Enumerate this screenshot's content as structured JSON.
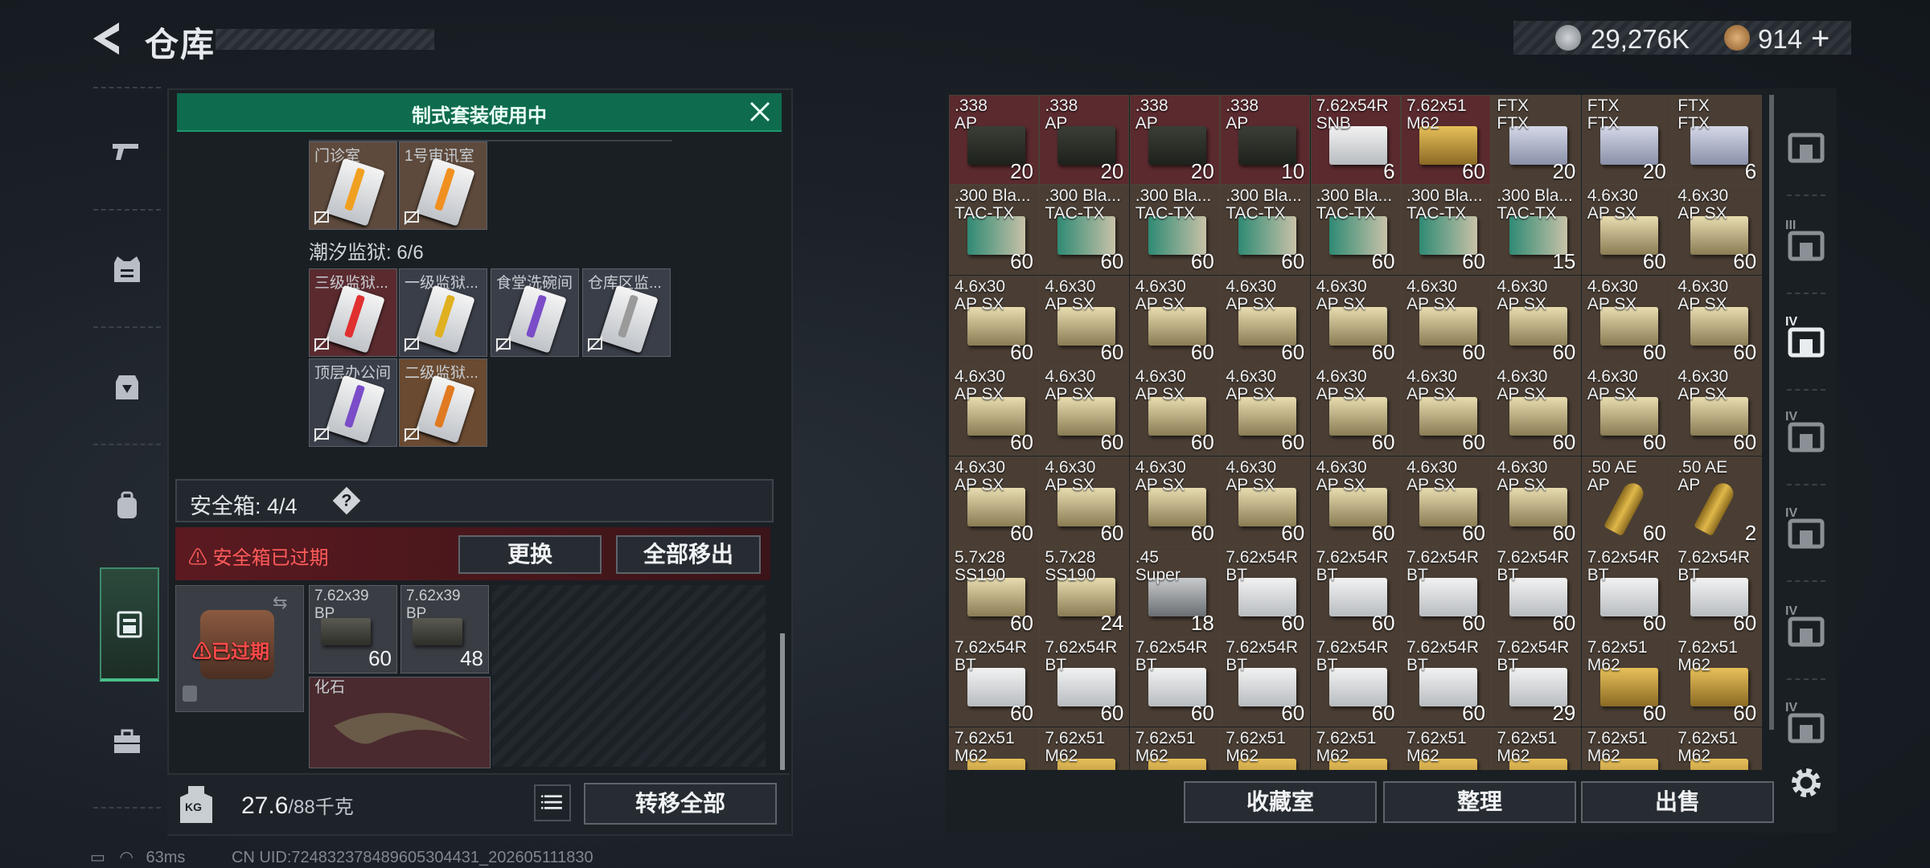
{
  "header": {
    "title": "仓库",
    "currency": [
      {
        "icon": "silver-coin-icon",
        "value": "29,276K"
      },
      {
        "icon": "bronze-coin-icon",
        "value": "914"
      }
    ]
  },
  "nav": [
    "weapon-icon",
    "armor-icon",
    "backpack-icon",
    "bag-icon",
    "container-icon",
    "toolbox-icon"
  ],
  "loadout_banner": "制式套装使用中",
  "keycards_top": [
    {
      "label": "门诊室",
      "color": "#f0a020"
    },
    {
      "label": "1号审讯室",
      "color": "#f09020"
    }
  ],
  "prison_label": "潮汐监狱: 6/6",
  "keycards_prison": [
    {
      "label": "三级监狱...",
      "bg": "#5a2a2e",
      "color": "#e03030"
    },
    {
      "label": "一级监狱...",
      "bg": "#3a3e48",
      "color": "#e0b020"
    },
    {
      "label": "食堂洗碗间",
      "bg": "#3a3e48",
      "color": "#7b4cc8"
    },
    {
      "label": "仓库区监...",
      "bg": "#3a3e48",
      "color": "#9a9a9a"
    },
    {
      "label": "顶层办公间",
      "bg": "#3a3e48",
      "color": "#7b4cc8"
    },
    {
      "label": "二级监狱...",
      "bg": "#6a4a30",
      "color": "#e07a20"
    }
  ],
  "safebox": {
    "label": "安全箱: 4/4",
    "help": "?",
    "expired_warning": "安全箱已过期",
    "replace_button": "更换",
    "remove_all_button": "全部移出",
    "slot_status": "已过期",
    "items": [
      {
        "label": "7.62x39\nBP",
        "count": "60"
      },
      {
        "label": "7.62x39\nBP",
        "count": "48"
      },
      {
        "label": "化石",
        "count": ""
      }
    ]
  },
  "weight": {
    "current": "27.6",
    "max": "/88千克",
    "icon_text": "KG"
  },
  "transfer_all_button": "转移全部",
  "stash_buttons": [
    "收藏室",
    "整理",
    "出售"
  ],
  "footer": {
    "ping": "63ms",
    "uid": "CN UID:724832378489605304431_202605111830"
  },
  "stash_items": [
    {
      "l": ".338\nAP",
      "c": "20",
      "t": "ammo_can",
      "bg": "#5a2a2e"
    },
    {
      "l": ".338\nAP",
      "c": "20",
      "t": "ammo_can",
      "bg": "#5a2a2e"
    },
    {
      "l": ".338\nAP",
      "c": "20",
      "t": "ammo_can",
      "bg": "#5a2a2e"
    },
    {
      "l": ".338\nAP",
      "c": "10",
      "t": "ammo_can",
      "bg": "#5a2a2e"
    },
    {
      "l": "7.62x54R\nSNB",
      "c": "6",
      "t": "white",
      "bg": "#5a2a2e"
    },
    {
      "l": "7.62x51\nM62",
      "c": "60",
      "t": "gold",
      "bg": "#5a2a2e"
    },
    {
      "l": "FTX\nFTX",
      "c": "20",
      "t": "silver",
      "bg": "#4a3e34"
    },
    {
      "l": "FTX\nFTX",
      "c": "20",
      "t": "silver",
      "bg": "#4a3e34"
    },
    {
      "l": "FTX\nFTX",
      "c": "6",
      "t": "silver",
      "bg": "#4a3e34"
    },
    {
      "l": ".300 Bla...\nTAC-TX",
      "c": "60",
      "t": "teal",
      "bg": "#4a3e34"
    },
    {
      "l": ".300 Bla...\nTAC-TX",
      "c": "60",
      "t": "teal",
      "bg": "#4a3e34"
    },
    {
      "l": ".300 Bla...\nTAC-TX",
      "c": "60",
      "t": "teal",
      "bg": "#4a3e34"
    },
    {
      "l": ".300 Bla...\nTAC-TX",
      "c": "60",
      "t": "teal",
      "bg": "#4a3e34"
    },
    {
      "l": ".300 Bla...\nTAC-TX",
      "c": "60",
      "t": "teal",
      "bg": "#4a3e34"
    },
    {
      "l": ".300 Bla...\nTAC-TX",
      "c": "60",
      "t": "teal",
      "bg": "#4a3e34"
    },
    {
      "l": ".300 Bla...\nTAC-TX",
      "c": "15",
      "t": "teal",
      "bg": "#4a3e34"
    },
    {
      "l": "4.6x30\nAP SX",
      "c": "60",
      "t": "tan",
      "bg": "#4a3e34"
    },
    {
      "l": "4.6x30\nAP SX",
      "c": "60",
      "t": "tan",
      "bg": "#4a3e34"
    },
    {
      "l": "4.6x30\nAP SX",
      "c": "60",
      "t": "tan",
      "bg": "#4a3e34"
    },
    {
      "l": "4.6x30\nAP SX",
      "c": "60",
      "t": "tan",
      "bg": "#4a3e34"
    },
    {
      "l": "4.6x30\nAP SX",
      "c": "60",
      "t": "tan",
      "bg": "#4a3e34"
    },
    {
      "l": "4.6x30\nAP SX",
      "c": "60",
      "t": "tan",
      "bg": "#4a3e34"
    },
    {
      "l": "4.6x30\nAP SX",
      "c": "60",
      "t": "tan",
      "bg": "#4a3e34"
    },
    {
      "l": "4.6x30\nAP SX",
      "c": "60",
      "t": "tan",
      "bg": "#4a3e34"
    },
    {
      "l": "4.6x30\nAP SX",
      "c": "60",
      "t": "tan",
      "bg": "#4a3e34"
    },
    {
      "l": "4.6x30\nAP SX",
      "c": "60",
      "t": "tan",
      "bg": "#4a3e34"
    },
    {
      "l": "4.6x30\nAP SX",
      "c": "60",
      "t": "tan",
      "bg": "#4a3e34"
    },
    {
      "l": "4.6x30\nAP SX",
      "c": "60",
      "t": "tan",
      "bg": "#4a3e34"
    },
    {
      "l": "4.6x30\nAP SX",
      "c": "60",
      "t": "tan",
      "bg": "#4a3e34"
    },
    {
      "l": "4.6x30\nAP SX",
      "c": "60",
      "t": "tan",
      "bg": "#4a3e34"
    },
    {
      "l": "4.6x30\nAP SX",
      "c": "60",
      "t": "tan",
      "bg": "#4a3e34"
    },
    {
      "l": "4.6x30\nAP SX",
      "c": "60",
      "t": "tan",
      "bg": "#4a3e34"
    },
    {
      "l": "4.6x30\nAP SX",
      "c": "60",
      "t": "tan",
      "bg": "#4a3e34"
    },
    {
      "l": "4.6x30\nAP SX",
      "c": "60",
      "t": "tan",
      "bg": "#4a3e34"
    },
    {
      "l": "4.6x30\nAP SX",
      "c": "60",
      "t": "tan",
      "bg": "#4a3e34"
    },
    {
      "l": "4.6x30\nAP SX",
      "c": "60",
      "t": "tan",
      "bg": "#4a3e34"
    },
    {
      "l": "4.6x30\nAP SX",
      "c": "60",
      "t": "tan",
      "bg": "#4a3e34"
    },
    {
      "l": "4.6x30\nAP SX",
      "c": "60",
      "t": "tan",
      "bg": "#4a3e34"
    },
    {
      "l": "4.6x30\nAP SX",
      "c": "60",
      "t": "tan",
      "bg": "#4a3e34"
    },
    {
      "l": "4.6x30\nAP SX",
      "c": "60",
      "t": "tan",
      "bg": "#4a3e34"
    },
    {
      "l": "4.6x30\nAP SX",
      "c": "60",
      "t": "tan",
      "bg": "#4a3e34"
    },
    {
      "l": "4.6x30\nAP SX",
      "c": "60",
      "t": "tan",
      "bg": "#4a3e34"
    },
    {
      "l": "4.6x30\nAP SX",
      "c": "60",
      "t": "tan",
      "bg": "#4a3e34"
    },
    {
      "l": ".50 AE\nAP",
      "c": "60",
      "t": "bullet",
      "bg": "#4a3e34"
    },
    {
      "l": ".50 AE\nAP",
      "c": "2",
      "t": "bullet",
      "bg": "#4a3e34"
    },
    {
      "l": "5.7x28\nSS190",
      "c": "60",
      "t": "tan",
      "bg": "#4a3e34"
    },
    {
      "l": "5.7x28\nSS190",
      "c": "24",
      "t": "tan",
      "bg": "#4a3e34"
    },
    {
      "l": ".45\nSuper",
      "c": "18",
      "t": "grey",
      "bg": "#4a3e34"
    },
    {
      "l": "7.62x54R\nBT",
      "c": "60",
      "t": "white",
      "bg": "#4a3e34"
    },
    {
      "l": "7.62x54R\nBT",
      "c": "60",
      "t": "white",
      "bg": "#4a3e34"
    },
    {
      "l": "7.62x54R\nBT",
      "c": "60",
      "t": "white",
      "bg": "#4a3e34"
    },
    {
      "l": "7.62x54R\nBT",
      "c": "60",
      "t": "white",
      "bg": "#4a3e34"
    },
    {
      "l": "7.62x54R\nBT",
      "c": "60",
      "t": "white",
      "bg": "#4a3e34"
    },
    {
      "l": "7.62x54R\nBT",
      "c": "60",
      "t": "white",
      "bg": "#4a3e34"
    },
    {
      "l": "7.62x54R\nBT",
      "c": "60",
      "t": "white",
      "bg": "#4a3e34"
    },
    {
      "l": "7.62x54R\nBT",
      "c": "60",
      "t": "white",
      "bg": "#4a3e34"
    },
    {
      "l": "7.62x54R\nBT",
      "c": "60",
      "t": "white",
      "bg": "#4a3e34"
    },
    {
      "l": "7.62x54R\nBT",
      "c": "60",
      "t": "white",
      "bg": "#4a3e34"
    },
    {
      "l": "7.62x54R\nBT",
      "c": "60",
      "t": "white",
      "bg": "#4a3e34"
    },
    {
      "l": "7.62x54R\nBT",
      "c": "60",
      "t": "white",
      "bg": "#4a3e34"
    },
    {
      "l": "7.62x54R\nBT",
      "c": "29",
      "t": "white",
      "bg": "#4a3e34"
    },
    {
      "l": "7.62x51\nM62",
      "c": "60",
      "t": "gold",
      "bg": "#4a3e34"
    },
    {
      "l": "7.62x51\nM62",
      "c": "60",
      "t": "gold",
      "bg": "#4a3e34"
    },
    {
      "l": "7.62x51\nM62",
      "c": "",
      "t": "gold",
      "bg": "#4a3e34"
    },
    {
      "l": "7.62x51\nM62",
      "c": "",
      "t": "gold",
      "bg": "#4a3e34"
    },
    {
      "l": "7.62x51\nM62",
      "c": "",
      "t": "gold",
      "bg": "#4a3e34"
    },
    {
      "l": "7.62x51\nM62",
      "c": "",
      "t": "gold",
      "bg": "#4a3e34"
    },
    {
      "l": "7.62x51\nM62",
      "c": "",
      "t": "gold",
      "bg": "#4a3e34"
    },
    {
      "l": "7.62x51\nM62",
      "c": "",
      "t": "gold",
      "bg": "#4a3e34"
    },
    {
      "l": "7.62x51\nM62",
      "c": "",
      "t": "gold",
      "bg": "#4a3e34"
    },
    {
      "l": "7.62x51\nM62",
      "c": "",
      "t": "gold",
      "bg": "#4a3e34"
    },
    {
      "l": "7.62x51\nM62",
      "c": "",
      "t": "gold",
      "bg": "#4a3e34"
    }
  ],
  "side_tabs": [
    {
      "icon": "stash-home-icon",
      "label": ""
    },
    {
      "icon": "tier3-storage-icon",
      "label": "III"
    },
    {
      "icon": "tier4-storage-icon",
      "label": "IV"
    },
    {
      "icon": "tier4-medical-icon",
      "label": "IV"
    },
    {
      "icon": "tier4-bag-icon",
      "label": "IV"
    },
    {
      "icon": "tier4-medkit-icon",
      "label": "IV"
    },
    {
      "icon": "tier4-armor-icon",
      "label": "IV"
    }
  ],
  "colors": {
    "accent_green": "#0f6b4e",
    "warning_red": "#ff5b5b"
  }
}
